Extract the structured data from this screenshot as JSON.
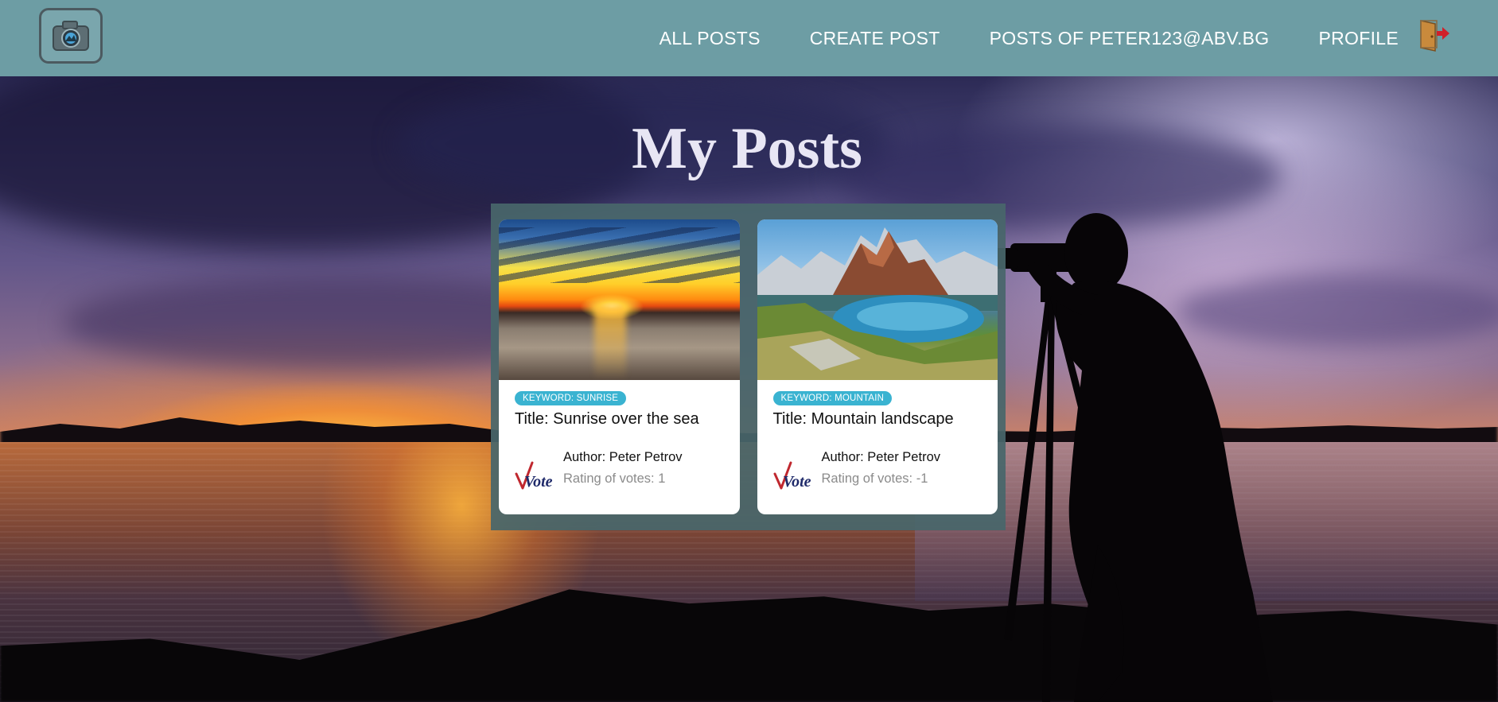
{
  "nav": {
    "logo_icon": "camera-logo-icon",
    "links": [
      "ALL POSTS",
      "CREATE POST",
      "POSTS OF PETER123@ABV.BG",
      "PROFILE"
    ],
    "logout_icon": "logout-door-icon",
    "text_color": "#ffffff",
    "background": "#6d9da4"
  },
  "page": {
    "title": "My Posts"
  },
  "posts": [
    {
      "image": "sunrise-over-sea-photo",
      "keyword": "KEYWORD: SUNRISE",
      "title": "Title: Sunrise over the sea",
      "author": "Author: Peter Petrov",
      "rating": "Rating of votes: 1",
      "vote_logo": "Vote"
    },
    {
      "image": "mountain-landscape-photo",
      "keyword": "KEYWORD: MOUNTAIN",
      "title": "Title: Mountain landscape",
      "author": "Author: Peter Petrov",
      "rating": "Rating of votes: -1",
      "vote_logo": "Vote"
    }
  ],
  "colors": {
    "badge": "#3ab3d1",
    "panel": "#48666a",
    "rating_text": "#8b8b8b"
  }
}
